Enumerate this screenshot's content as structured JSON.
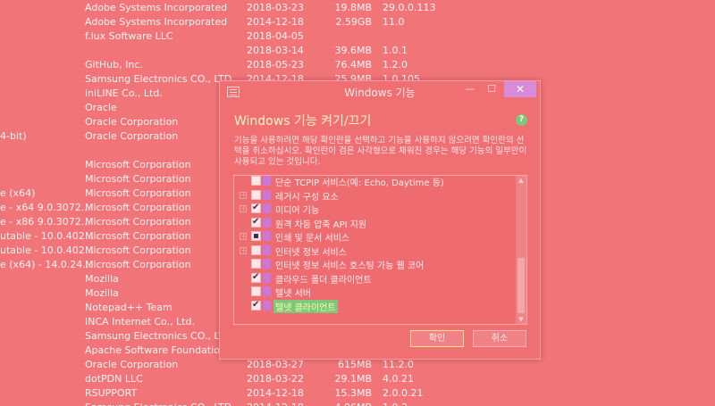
{
  "background_list": [
    {
      "name": "",
      "publisher": "Adobe Systems Incorporated",
      "date": "2018-03-23",
      "size": "19.8MB",
      "version": "29.0.0.113"
    },
    {
      "name": "",
      "publisher": "Adobe Systems Incorporated",
      "date": "2014-12-18",
      "size": "2.59GB",
      "version": "11.0"
    },
    {
      "name": "",
      "publisher": "f.lux Software LLC",
      "date": "2018-04-05",
      "size": "",
      "version": ""
    },
    {
      "name": "",
      "publisher": "",
      "date": "2018-03-14",
      "size": "39.6MB",
      "version": "1.0.1"
    },
    {
      "name": "",
      "publisher": "GitHub, Inc.",
      "date": "2018-05-23",
      "size": "76.4MB",
      "version": "1.2.0"
    },
    {
      "name": "",
      "publisher": "Samsung Electronics CO., LTD.",
      "date": "2014-12-18",
      "size": "25.9MB",
      "version": "1.0.105"
    },
    {
      "name": "",
      "publisher": "iniLINE Co., Ltd.",
      "date": "",
      "size": "",
      "version": ""
    },
    {
      "name": "",
      "publisher": "Oracle",
      "date": "",
      "size": "",
      "version": ""
    },
    {
      "name": "",
      "publisher": "Oracle Corporation",
      "date": "",
      "size": "",
      "version": ""
    },
    {
      "name": "4-bit)",
      "publisher": "Oracle Corporation",
      "date": "",
      "size": "",
      "version": ""
    },
    {
      "name": "",
      "publisher": "",
      "date": "",
      "size": "",
      "version": ""
    },
    {
      "name": "",
      "publisher": "Microsoft Corporation",
      "date": "",
      "size": "",
      "version": ""
    },
    {
      "name": "",
      "publisher": "Microsoft Corporation",
      "date": "",
      "size": "",
      "version": ""
    },
    {
      "name": "e (x64)",
      "publisher": "Microsoft Corporation",
      "date": "",
      "size": "",
      "version": ""
    },
    {
      "name": "e - x64 9.0.3072...",
      "publisher": "Microsoft Corporation",
      "date": "",
      "size": "",
      "version": ""
    },
    {
      "name": "e - x86 9.0.3072...",
      "publisher": "Microsoft Corporation",
      "date": "",
      "size": "",
      "version": ""
    },
    {
      "name": "utable - 10.0.402...",
      "publisher": "Microsoft Corporation",
      "date": "",
      "size": "",
      "version": ""
    },
    {
      "name": "utable - 10.0.402...",
      "publisher": "Microsoft Corporation",
      "date": "",
      "size": "",
      "version": ""
    },
    {
      "name": "e (x64) - 14.0.24...",
      "publisher": "Microsoft Corporation",
      "date": "",
      "size": "",
      "version": ""
    },
    {
      "name": "",
      "publisher": "Mozilla",
      "date": "",
      "size": "",
      "version": ""
    },
    {
      "name": "",
      "publisher": "Mozilla",
      "date": "",
      "size": "",
      "version": ""
    },
    {
      "name": "",
      "publisher": "Notepad++ Team",
      "date": "",
      "size": "",
      "version": ""
    },
    {
      "name": "",
      "publisher": "INCA Internet Co., Ltd.",
      "date": "",
      "size": "",
      "version": ""
    },
    {
      "name": "",
      "publisher": "Samsung Electronics CO., LTD.",
      "date": "",
      "size": "",
      "version": ""
    },
    {
      "name": "",
      "publisher": "Apache Software Foundation",
      "date": "",
      "size": "",
      "version": ""
    },
    {
      "name": "",
      "publisher": "Oracle Corporation",
      "date": "2018-03-27",
      "size": "615MB",
      "version": "11.2.0"
    },
    {
      "name": "",
      "publisher": "dotPDN LLC",
      "date": "2018-03-22",
      "size": "29.1MB",
      "version": "4.0.21"
    },
    {
      "name": "",
      "publisher": "RSUPPORT",
      "date": "2014-12-18",
      "size": "15.3MB",
      "version": "2.0.0.21"
    },
    {
      "name": "",
      "publisher": "Samsung Electronics CO., LTD.",
      "date": "2014-12-18",
      "size": "4.06MB",
      "version": "1.0.2"
    }
  ],
  "dialog": {
    "title": "Windows 기능",
    "minimize": "—",
    "maximize": "☐",
    "close": "✕",
    "heading": "Windows 기능 켜기/끄기",
    "help": "?",
    "description": "기능을 사용하려면 해당 확인란을 선택하고 기능을 사용하지 않으려면 확인란의 선택을 취소하십시오. 확인란이 검은 사각형으로 채워진 경우는 해당 기능의 일부만이 사용되고 있는 것입니다.",
    "features": [
      {
        "label": "단순 TCPIP 서비스(예: Echo, Daytime 등)",
        "state": "unchecked",
        "expandable": false,
        "selected": false
      },
      {
        "label": "레거시 구성 요소",
        "state": "unchecked",
        "expandable": true,
        "selected": false
      },
      {
        "label": "미디어 기능",
        "state": "checked",
        "expandable": true,
        "selected": false
      },
      {
        "label": "원격 차등 압축 API 지원",
        "state": "checked",
        "expandable": false,
        "selected": false
      },
      {
        "label": "인쇄 및 문서 서비스",
        "state": "partial",
        "expandable": true,
        "selected": false
      },
      {
        "label": "인터넷 정보 서비스",
        "state": "unchecked",
        "expandable": true,
        "selected": false
      },
      {
        "label": "인터넷 정보 서비스 호스팅 가능 웹 코어",
        "state": "unchecked",
        "expandable": false,
        "selected": false
      },
      {
        "label": "클라우드 폴더 클라이언트",
        "state": "checked",
        "expandable": false,
        "selected": false
      },
      {
        "label": "텔넷 서버",
        "state": "unchecked",
        "expandable": false,
        "selected": false
      },
      {
        "label": "텔넷 클라이언트",
        "state": "checked",
        "expandable": false,
        "selected": true
      }
    ],
    "scroll_up": "▲",
    "scroll_down": "▼",
    "ok_label": "확인",
    "cancel_label": "취소"
  }
}
